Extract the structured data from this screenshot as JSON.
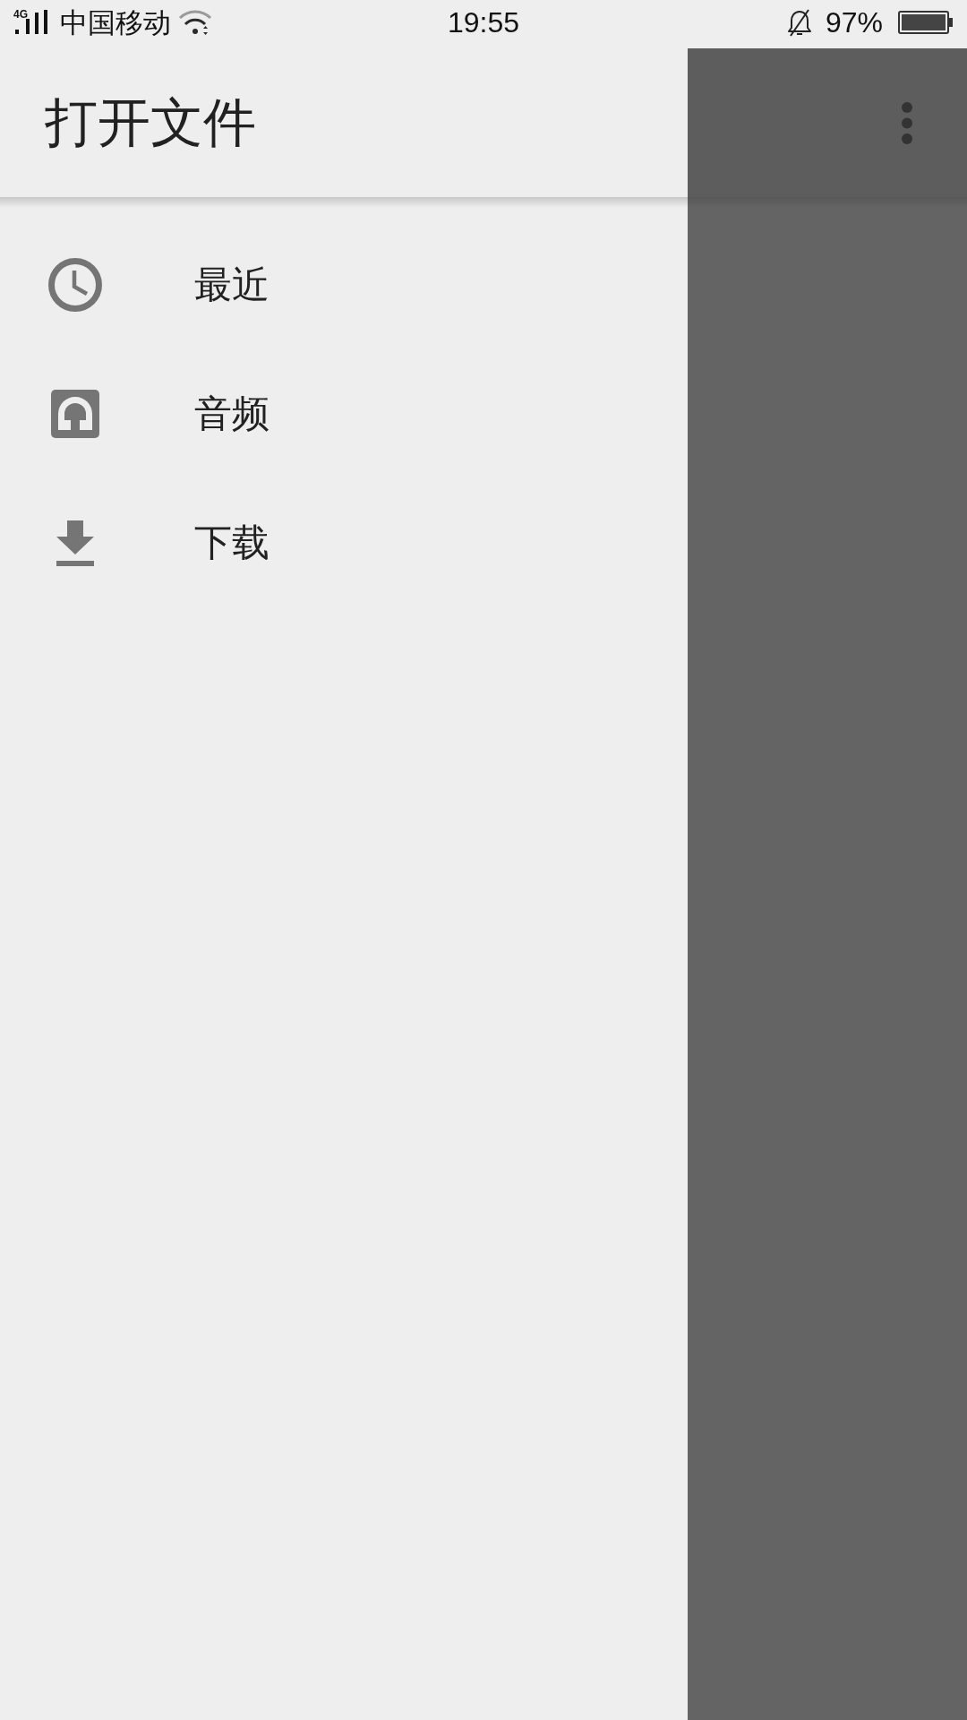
{
  "status_bar": {
    "network_type": "4G",
    "carrier": "中国移动",
    "time": "19:55",
    "battery": "97%"
  },
  "drawer": {
    "title": "打开文件",
    "items": [
      {
        "kind": "recent",
        "label": "最近"
      },
      {
        "kind": "audio",
        "label": "音频"
      },
      {
        "kind": "download",
        "label": "下载"
      }
    ]
  }
}
